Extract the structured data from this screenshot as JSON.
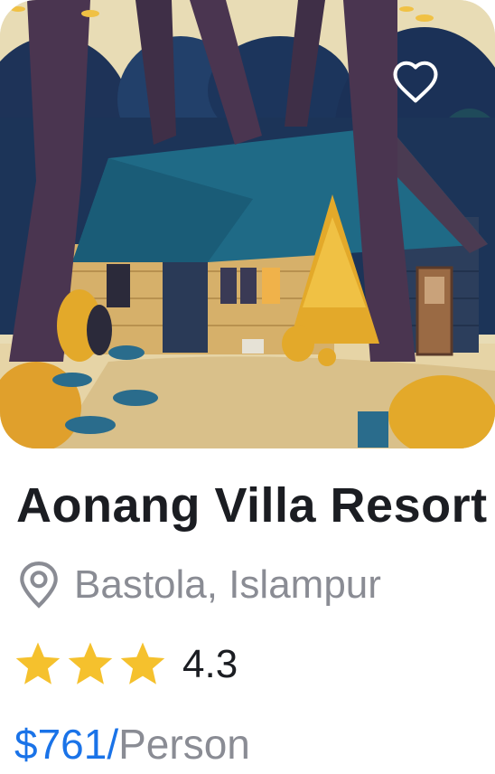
{
  "listing": {
    "title": "Aonang Villa Resort",
    "location": "Bastola, Islampur",
    "rating": "4.3",
    "stars_filled": 3,
    "price_amount": "$761/",
    "price_unit": "Person"
  },
  "icons": {
    "favorite": "heart-icon",
    "location": "location-pin-icon",
    "star": "star-icon"
  },
  "colors": {
    "accent": "#1a73e8",
    "muted_text": "#8a8c94",
    "primary_text": "#1b1d22",
    "star": "#f5c12d"
  }
}
